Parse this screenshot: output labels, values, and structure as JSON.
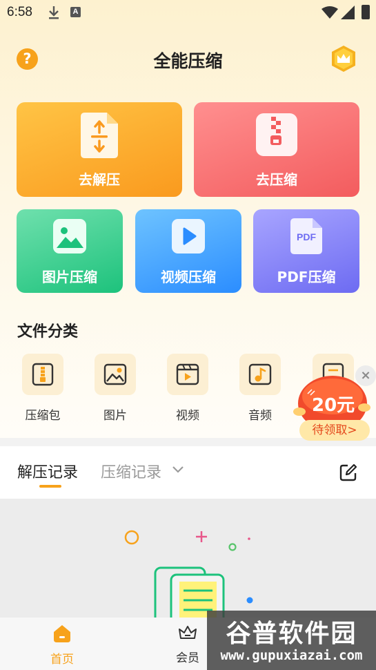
{
  "status_bar": {
    "time": "6:58",
    "notification_letter": "A"
  },
  "header": {
    "title": "全能压缩",
    "help_glyph": "?"
  },
  "cards": {
    "unzip": "去解压",
    "zip": "去压缩",
    "image": "图片压缩",
    "video": "视频压缩",
    "pdf": "PDF压缩",
    "pdf_icon_text": "PDF"
  },
  "section": {
    "title": "文件分类"
  },
  "categories": [
    {
      "label": "压缩包",
      "icon": "archive-icon"
    },
    {
      "label": "图片",
      "icon": "image-icon"
    },
    {
      "label": "视频",
      "icon": "video-icon"
    },
    {
      "label": "音频",
      "icon": "audio-icon"
    }
  ],
  "promo": {
    "amount": "20元",
    "action": "待领取>",
    "close": "×"
  },
  "records": {
    "tab_active": "解压记录",
    "tab_inactive": "压缩记录"
  },
  "bottom_nav": {
    "home": "首页",
    "vip": "会员"
  },
  "watermark": {
    "name": "谷普软件园",
    "url": "www.gupuxiazai.com"
  },
  "colors": {
    "accent": "#f7a21b",
    "unzip_card": "#fa9a1e",
    "zip_card": "#f35c5e",
    "image_card": "#1dc27c",
    "video_card": "#2b8dff",
    "pdf_card": "#6d6bf2"
  }
}
